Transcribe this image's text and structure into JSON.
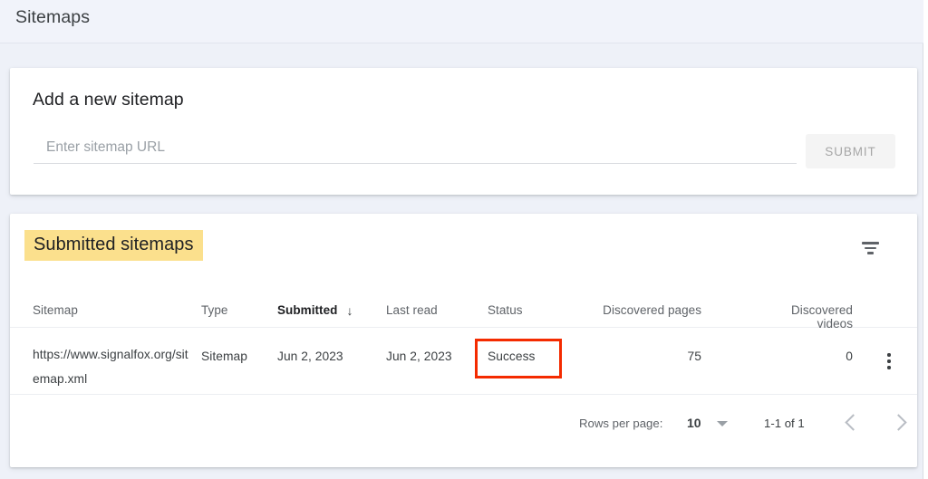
{
  "header": {
    "title": "Sitemaps"
  },
  "add_sitemap": {
    "heading": "Add a new sitemap",
    "input_value": "",
    "input_placeholder": "Enter sitemap URL",
    "submit_label": "SUBMIT"
  },
  "submitted": {
    "heading": "Submitted sitemaps",
    "filter_icon": "filter-list-icon",
    "columns": [
      "Sitemap",
      "Type",
      "Submitted",
      "Last read",
      "Status",
      "Discovered pages",
      "Discovered videos"
    ],
    "sort": {
      "column": "Submitted",
      "arrow": "↓"
    },
    "rows": [
      {
        "sitemap": "https://www.signalfox.org/sitemap.xml",
        "type": "Sitemap",
        "submitted": "Jun 2, 2023",
        "last_read": "Jun 2, 2023",
        "status": "Success",
        "discovered_pages": "75",
        "discovered_videos": "0",
        "menu_icon": "more-vert-icon"
      }
    ]
  },
  "pagination": {
    "rows_per_page_label": "Rows per page:",
    "rows_per_page_value": "10",
    "range": "1-1 of 1",
    "prev_icon": "chevron-left-icon",
    "next_icon": "chevron-right-icon"
  },
  "annotation": {
    "highlight_color": "#f42b00",
    "target": "Success"
  },
  "colors": {
    "page_background": "#eef1f8",
    "card_background": "#ffffff",
    "heading_highlight": "#fbe08d",
    "status_success": "#1e8e3e",
    "annotation_box": "#f42b00"
  }
}
